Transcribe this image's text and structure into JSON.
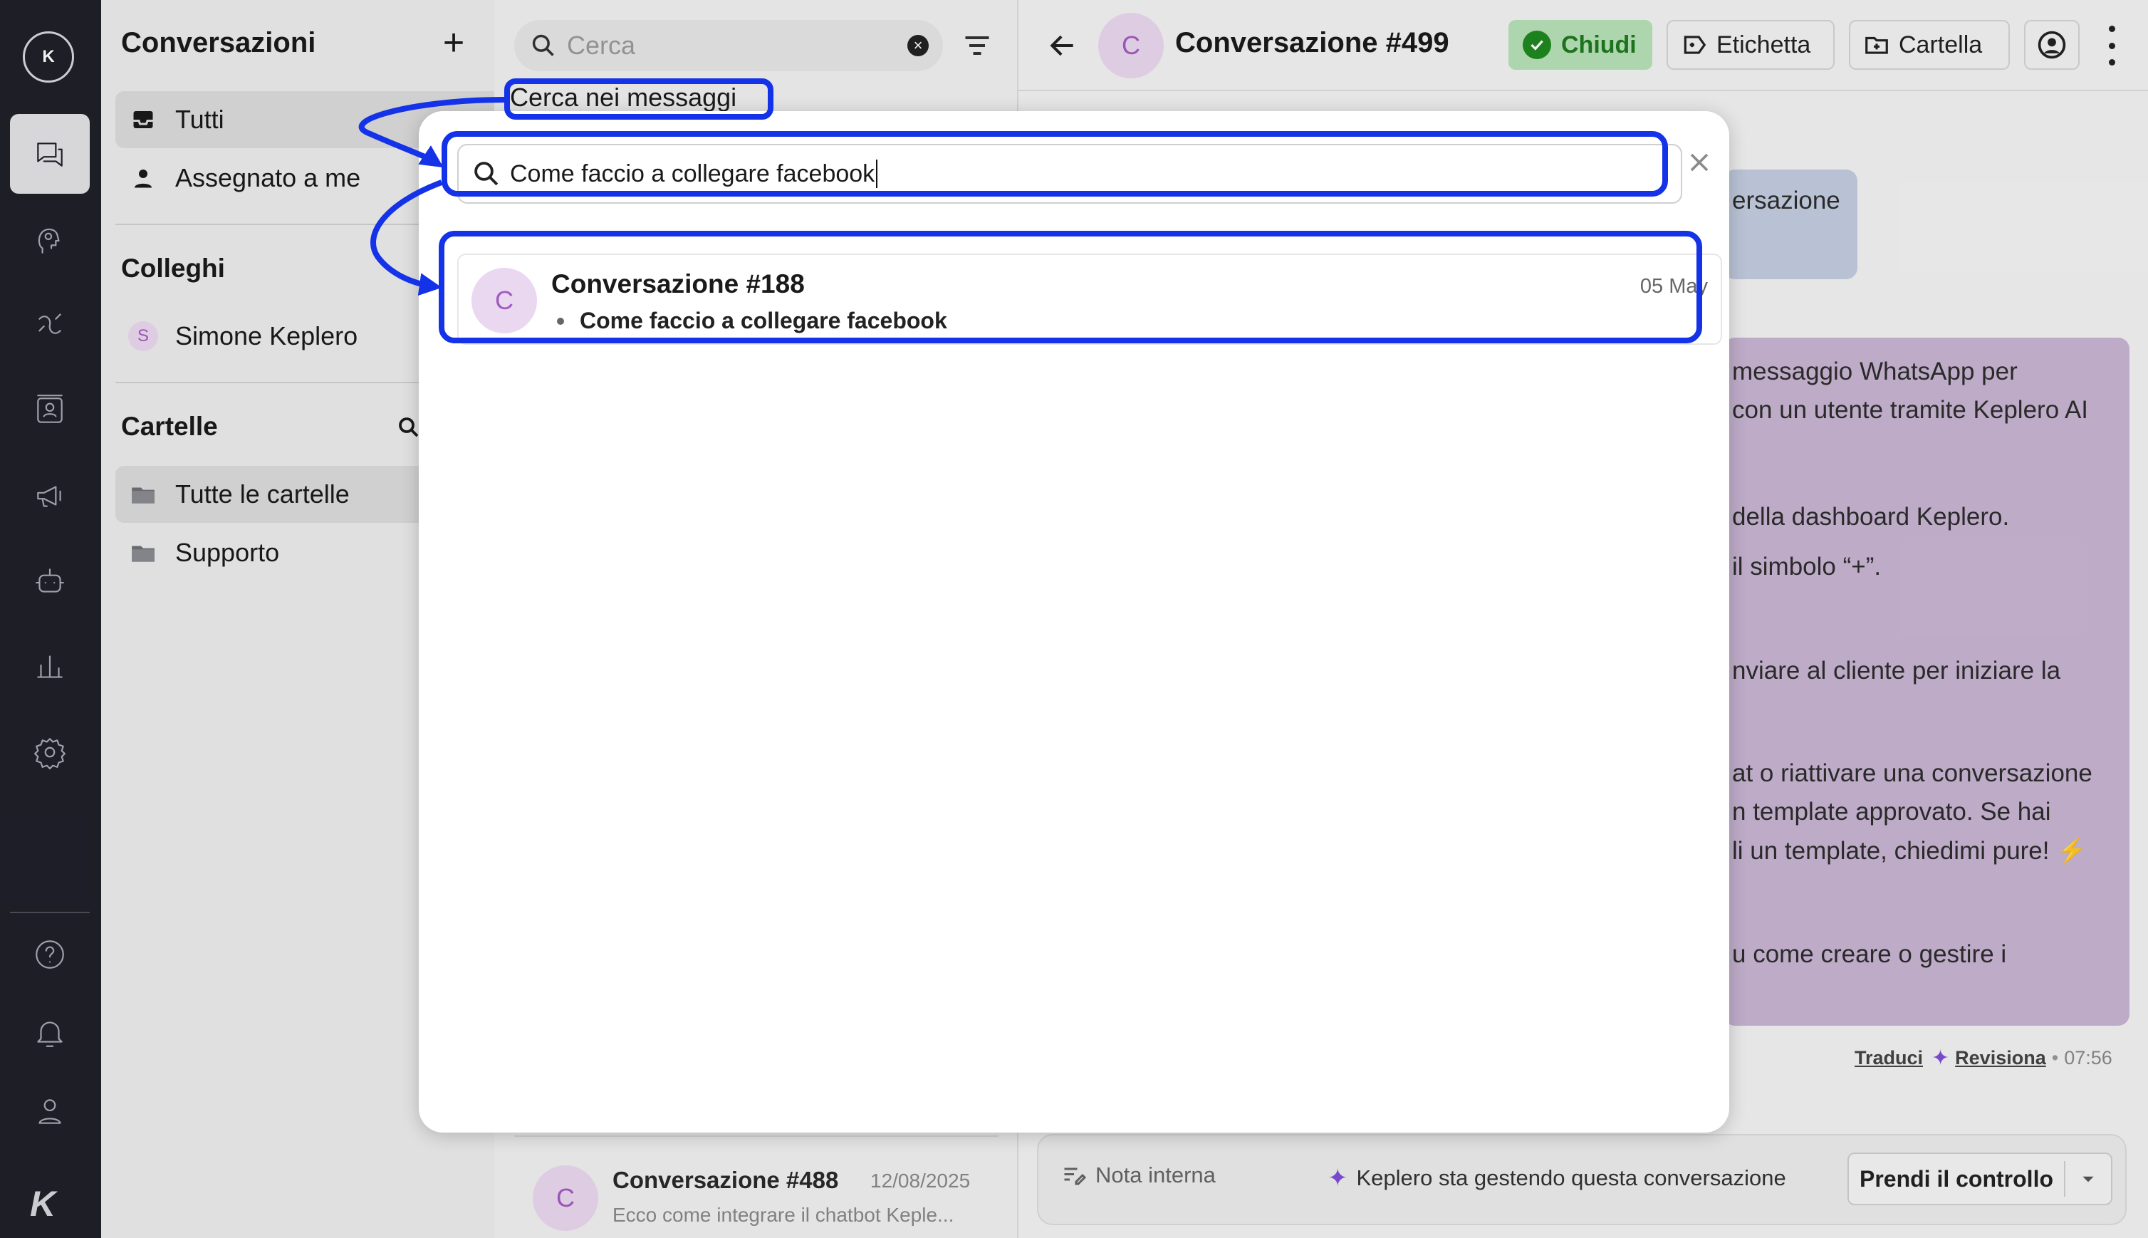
{
  "sidebar": {
    "title": "Conversazioni",
    "inbox_items": [
      {
        "label": "Tutti"
      },
      {
        "label": "Assegnato a me"
      }
    ],
    "colleagues_title": "Colleghi",
    "colleagues": [
      {
        "initial": "S",
        "name": "Simone Keplero"
      }
    ],
    "folders_title": "Cartelle",
    "folders": [
      {
        "label": "Tutte le cartelle"
      },
      {
        "label": "Supporto"
      }
    ]
  },
  "list": {
    "search_placeholder": "Cerca",
    "search_messages_label": "Cerca nei messaggi",
    "items": [
      {
        "initial": "C",
        "title": "Conversazione #488",
        "date": "12/08/2025",
        "preview": "Ecco come integrare il chatbot Keple..."
      }
    ]
  },
  "chat": {
    "avatar_initial": "C",
    "title": "Conversazione #499",
    "buttons": {
      "close": "Chiudi",
      "label": "Etichetta",
      "folder": "Cartella"
    },
    "blue_bubble_text": "ersazione",
    "message_lines": [
      "messaggio WhatsApp per",
      "con un utente tramite Keplero AI",
      "della dashboard Keplero.",
      "il simbolo “+”.",
      "nviare al cliente per iniziare la",
      "at o riattivare una conversazione",
      "n template approvato. Se hai",
      "li un template, chiedimi pure! ⚡",
      "u come creare o gestire i"
    ],
    "meta": {
      "translate": "Traduci",
      "revise": "Revisiona",
      "time": "07:56"
    },
    "composer": {
      "internal_note": "Nota interna",
      "ai_status": "Keplero sta gestendo questa conversazione",
      "take_control": "Prendi il controllo"
    }
  },
  "search_modal": {
    "query": "Come faccio a collegare facebook",
    "results": [
      {
        "initial": "C",
        "title": "Conversazione #188",
        "date": "05 May",
        "snippet": "Come faccio a collegare facebook"
      }
    ]
  },
  "colors": {
    "rail_bg": "#1f2029",
    "highlight": "#1432e8",
    "avatar_bg": "#ead7f0",
    "avatar_text": "#a35bc0",
    "close_green": "#b8e2b8"
  }
}
